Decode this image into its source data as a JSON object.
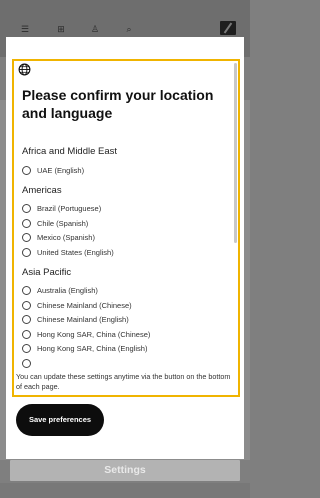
{
  "background": {
    "header_icons": [
      "menu-icon",
      "cart-icon",
      "user-icon",
      "search-icon"
    ],
    "settings_label": "Settings"
  },
  "dialog": {
    "title": "Please confirm your location and language",
    "regions": [
      {
        "name": "Africa and Middle East",
        "options": [
          "UAE (English)"
        ]
      },
      {
        "name": "Americas",
        "options": [
          "Brazil (Portuguese)",
          "Chile (Spanish)",
          "Mexico (Spanish)",
          "United States (English)"
        ]
      },
      {
        "name": "Asia Pacific",
        "options": [
          "Australia (English)",
          "Chinese Mainland (Chinese)",
          "Chinese Mainland (English)",
          "Hong Kong SAR, China (Chinese)",
          "Hong Kong SAR, China (English)"
        ]
      }
    ],
    "note": "You can update these settings anytime via the button on the bottom of each page.",
    "save_label": "Save preferences"
  },
  "colors": {
    "focus_outline": "#f0b400",
    "button_bg": "#0d0d0d"
  }
}
